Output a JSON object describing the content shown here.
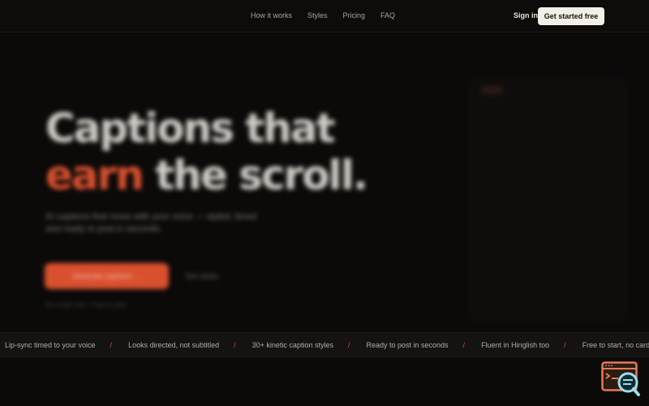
{
  "nav": {
    "links": [
      "How it works",
      "Styles",
      "Pricing",
      "FAQ"
    ],
    "signin": "Sign in",
    "cta": "Get started free"
  },
  "hero": {
    "title_line1": "Captions that",
    "title_accent": "earn",
    "title_rest": "the scroll.",
    "subtitle": "AI captions that move with your voice — styled, timed and ready to post in seconds.",
    "cta": "Generate captions →",
    "secondary": "See styles",
    "note": "No credit card · Free to start"
  },
  "ticker": {
    "items": [
      "Lip-sync timed to your voice",
      "Looks directed, not subtitled",
      "30+ kinetic caption styles",
      "Ready to post in seconds",
      "Fluent in Hinglish too",
      "Free to start, no card needed"
    ],
    "separator": "/"
  },
  "colors": {
    "accent": "#d9502f",
    "background": "#0b0a09",
    "cta_light": "#f3efe8"
  },
  "widget": {
    "icon": "terminal-search-icon"
  }
}
